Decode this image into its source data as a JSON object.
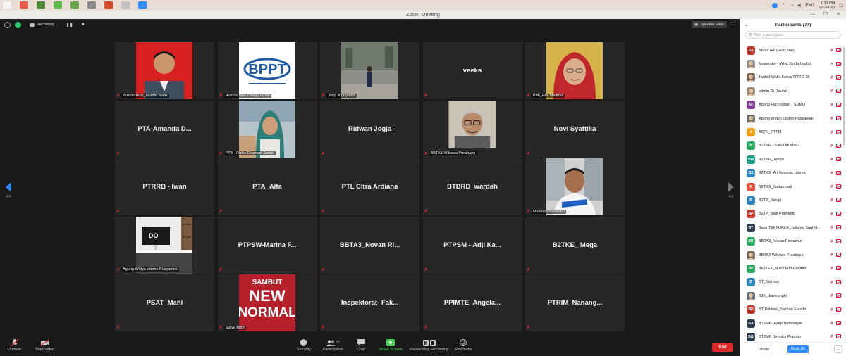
{
  "taskbar": {
    "icons": [
      {
        "name": "windows-start-icon",
        "color": "#f5f5f5"
      },
      {
        "name": "chrome-icon",
        "color": "#e25d4a"
      },
      {
        "name": "file-explorer-icon",
        "color": "#4f8a3c"
      },
      {
        "name": "whatsapp-icon",
        "color": "#5fb84b"
      },
      {
        "name": "app-icon",
        "color": "#6aa84f"
      },
      {
        "name": "media-icon",
        "color": "#8a8a8a"
      },
      {
        "name": "powerpoint-icon",
        "color": "#d24726"
      },
      {
        "name": "app-icon-2",
        "color": "#c0c0c0"
      },
      {
        "name": "zoom-icon",
        "color": "#2d8cff"
      }
    ],
    "lang": "ENG",
    "time": "1:31 PM",
    "date": "17-Jul-20"
  },
  "window": {
    "title": "Zoom Meeting"
  },
  "meeting": {
    "recording_label": "Recording...",
    "speaker_view_label": "Speaker View",
    "page_left": "4/4",
    "page_right": "4/4"
  },
  "tiles": [
    {
      "label": "Pusbindiklat_Nurdin Sjidik",
      "name": "",
      "photo": "portrait-red"
    },
    {
      "label": "Humas BPPT-Babji Tarsia",
      "name": "",
      "photo": "bppt-logo",
      "logo_text": "BPPT"
    },
    {
      "label": "Josp Jupriyanto",
      "name": "",
      "photo": "outdoor-building"
    },
    {
      "label": "",
      "name": "veeka",
      "photo": ""
    },
    {
      "label": "PMI_Eka Melfrina",
      "name": "",
      "photo": "portrait-hijab"
    },
    {
      "label": "",
      "name": "PTA-Amanda  D...",
      "photo": ""
    },
    {
      "label": "PTB - Rizka Ekamatri Sahile",
      "name": "",
      "photo": "outdoor-hijab"
    },
    {
      "label": "",
      "name": "Ridwan Jogja",
      "photo": ""
    },
    {
      "label": "BBTA3-Wibawa Purabaya",
      "name": "",
      "photo": "portrait-glasses"
    },
    {
      "label": "",
      "name": "Novi Syaftika",
      "photo": ""
    },
    {
      "label": "",
      "name": "PTRRB - Iwan",
      "photo": ""
    },
    {
      "label": "",
      "name": "PTA_Alfa",
      "photo": ""
    },
    {
      "label": "",
      "name": "PTL Citra Ardiana",
      "photo": ""
    },
    {
      "label": "",
      "name": "BTBRD_wardah",
      "photo": ""
    },
    {
      "label": "Madsaid Rprenteu",
      "name": "",
      "photo": "portrait-car"
    },
    {
      "label": "Agung Widyo Utomo Pusyantek",
      "name": "",
      "photo": "desk-setup",
      "logo_text": "DO"
    },
    {
      "label": "",
      "name": "PTPSW-Marina  F...",
      "photo": ""
    },
    {
      "label": "",
      "name": "BBTA3_Novan  Ri...",
      "photo": ""
    },
    {
      "label": "",
      "name": "PTPSM - Adji  Ka...",
      "photo": ""
    },
    {
      "label": "",
      "name": "B2TKE_ Mega",
      "photo": ""
    },
    {
      "label": "",
      "name": "PSAT_Mahi",
      "photo": ""
    },
    {
      "label": "Surya Bppt",
      "name": "",
      "photo": "new-normal",
      "logo_text": "SAMBUT NEW NORMAL"
    },
    {
      "label": "",
      "name": "Inspektorat-  Fak...",
      "photo": ""
    },
    {
      "label": "",
      "name": "PPIMTE_Angela...",
      "photo": ""
    },
    {
      "label": "",
      "name": "PTRIM_Nanang...",
      "photo": ""
    }
  ],
  "toolbar": {
    "unmute": "Unmute",
    "start_video": "Start Video",
    "security": "Security",
    "participants": "Participants",
    "participants_count": "77",
    "chat": "Chat",
    "share_screen": "Share Screen",
    "record": "Pause/Stop Recording",
    "reactions": "Reactions",
    "end": "End"
  },
  "panel": {
    "title": "Participants (77)",
    "search_placeholder": "Find a participant",
    "invite": "Invite",
    "mute_all": "Mute All",
    "more": "...",
    "participants": [
      {
        "initials": "SA",
        "color": "#c0392b",
        "name": "Septa Adi (Host, me)",
        "photo": false
      },
      {
        "initials": "",
        "color": "#8e8e8e",
        "name": "Moderator - Wiwi Syafarhadiati",
        "photo": true
      },
      {
        "initials": "",
        "color": "#7a6a5a",
        "name": "Tauhid Wakil Ketua TFRIC-19",
        "photo": true
      },
      {
        "initials": "",
        "color": "#9a8a7a",
        "name": "admin Dr. Tauhid",
        "photo": true
      },
      {
        "initials": "AF",
        "color": "#7d3c98",
        "name": "Agung Fachrudian - SDMO",
        "photo": false
      },
      {
        "initials": "",
        "color": "#6d6d6d",
        "name": "Agung Widyo Utomo Pusyantek",
        "photo": true
      },
      {
        "initials": "A",
        "color": "#f39c12",
        "name": "ASRI _PTFM",
        "photo": false
      },
      {
        "initials": "B",
        "color": "#27ae60",
        "name": "B2TKE - Saiful Mukhid-",
        "photo": false
      },
      {
        "initials": "BM",
        "color": "#16a085",
        "name": "B2TKE_ Mega",
        "photo": false
      },
      {
        "initials": "BS",
        "color": "#2e86c1",
        "name": "B2TKS_Ari Susanto Utomo",
        "photo": false
      },
      {
        "initials": "B",
        "color": "#e74c3c",
        "name": "B2TKS_Sudarmadi",
        "photo": false
      },
      {
        "initials": "B",
        "color": "#2e86c1",
        "name": "B2TP_Palupi",
        "photo": false
      },
      {
        "initials": "BP",
        "color": "#c0392b",
        "name": "B2TP_Sigit Purwanto",
        "photo": false
      },
      {
        "initials": "BT",
        "color": "#2c3e50",
        "name": "Balai TEKSURLA_Julianto Saut H...",
        "photo": false
      },
      {
        "initials": "BR",
        "color": "#27ae60",
        "name": "BBTA3_Novan Risnawan",
        "photo": false
      },
      {
        "initials": "",
        "color": "#7a6a5a",
        "name": "BBTA3-Wibawa Purabaya",
        "photo": true
      },
      {
        "initials": "BF",
        "color": "#27ae60",
        "name": "BIOTEK_Nurul Fitri Hanifah",
        "photo": false
      },
      {
        "initials": "B",
        "color": "#2e86c1",
        "name": "BT_Salman",
        "photo": false
      },
      {
        "initials": "",
        "color": "#5d6d7e",
        "name": "BJK_diannungki",
        "photo": true
      },
      {
        "initials": "BP",
        "color": "#c0392b",
        "name": "BT Polimer_Salman Fanshi",
        "photo": false
      },
      {
        "initials": "BA",
        "color": "#2c3e50",
        "name": "BT2MP- Asep Nurhidayat",
        "photo": false
      },
      {
        "initials": "BG",
        "color": "#2c3e50",
        "name": "BT2MP Girindro Pradoto",
        "photo": false
      }
    ]
  }
}
